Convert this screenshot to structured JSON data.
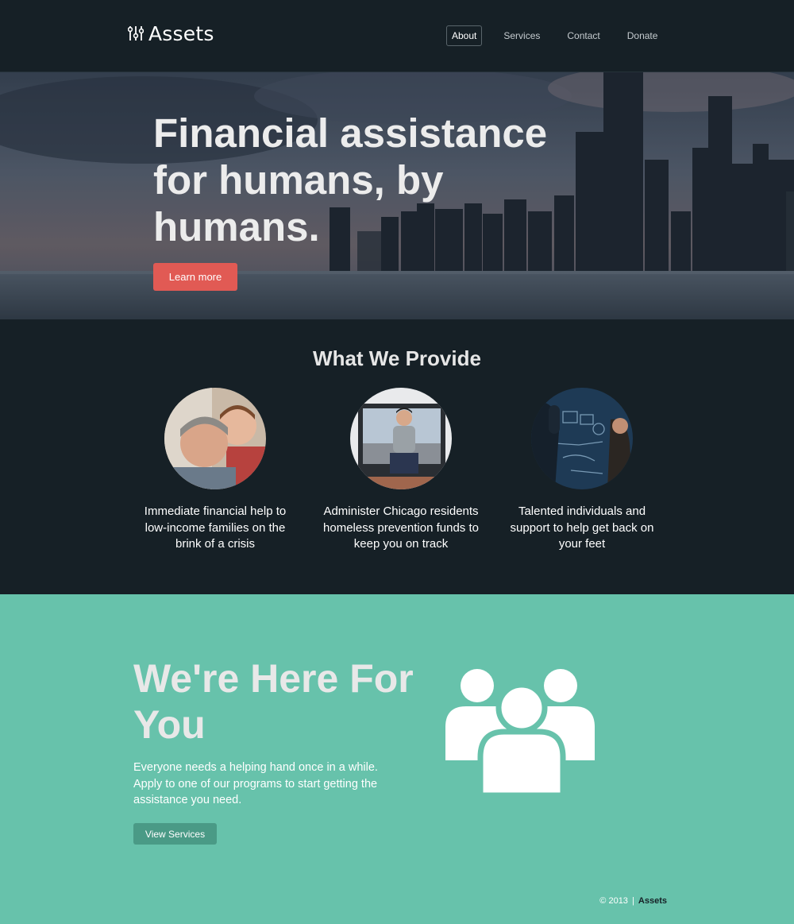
{
  "nav": {
    "brand": "Assets",
    "links": [
      {
        "label": "About"
      },
      {
        "label": "Services"
      },
      {
        "label": "Contact"
      },
      {
        "label": "Donate"
      }
    ]
  },
  "hero": {
    "title": "Financial assistance for humans, by humans.",
    "button_label": "Learn more"
  },
  "provide": {
    "title": "What We Provide",
    "features": [
      {
        "text": "Immediate financial help to low-income families on the brink of a crisis"
      },
      {
        "text": "Administer Chicago residents homeless prevention funds to keep you on track"
      },
      {
        "text": "Talented individuals and support to help get back on your feet"
      }
    ]
  },
  "here": {
    "title": "We're Here For You",
    "text": "Everyone needs a helping hand once in a while. Apply to one of our programs to start getting the assistance you need.",
    "button_label": "View Services"
  },
  "footer": {
    "copyright": "© 2013",
    "separator": "|",
    "brand": "Assets"
  },
  "colors": {
    "dark_bg": "#162026",
    "accent_red": "#e15a54",
    "teal_bg": "#67c2ab",
    "teal_button": "#4a9a86"
  },
  "icons": {
    "brand": "sliders-icon",
    "section_graphic": "people-group-icon"
  }
}
